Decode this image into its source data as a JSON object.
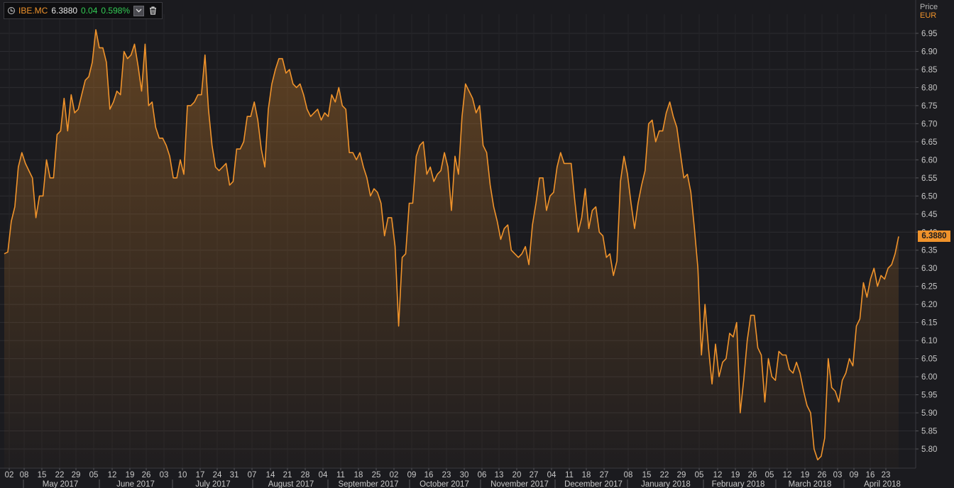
{
  "toolbar": {
    "ticker": "IBE.MC",
    "last_price": "6.3880",
    "change": "0.04",
    "change_pct": "0.598%",
    "dropdown_icon": "chevron-down-icon",
    "delete_icon": "trash-icon"
  },
  "axis_header": {
    "label": "Price",
    "currency": "EUR"
  },
  "last_value_badge": "6.3880",
  "colors": {
    "line": "#f0932b",
    "background": "#1b1b1f",
    "grid": "#2c2c31",
    "change_positive": "#33cc55"
  },
  "chart_data": {
    "type": "area",
    "ylim": [
      5.75,
      6.99
    ],
    "y_ticks": [
      "5.80",
      "5.85",
      "5.90",
      "5.95",
      "6.00",
      "6.05",
      "6.10",
      "6.15",
      "6.20",
      "6.25",
      "6.30",
      "6.35",
      "6.40",
      "6.45",
      "6.50",
      "6.55",
      "6.60",
      "6.65",
      "6.70",
      "6.75",
      "6.80",
      "6.85",
      "6.90",
      "6.95"
    ],
    "x_tick_labels": [
      "02",
      "08",
      "15",
      "22",
      "29",
      "05",
      "12",
      "19",
      "26",
      "03",
      "10",
      "17",
      "24",
      "31",
      "07",
      "14",
      "21",
      "28",
      "04",
      "11",
      "18",
      "25",
      "02",
      "09",
      "16",
      "23",
      "30",
      "06",
      "13",
      "20",
      "27",
      "04",
      "11",
      "18",
      "27",
      "08",
      "15",
      "22",
      "29",
      "05",
      "12",
      "19",
      "26",
      "05",
      "12",
      "19",
      "26",
      "03",
      "09",
      "16",
      "23"
    ],
    "month_labels": [
      "May 2017",
      "June 2017",
      "July 2017",
      "August 2017",
      "September 2017",
      "October 2017",
      "November 2017",
      "December 2017",
      "January 2018",
      "February 2018",
      "March 2018",
      "April 2018"
    ],
    "grid": true,
    "series": [
      {
        "values": [
          6.34,
          6.345,
          6.43,
          6.47,
          6.58,
          6.62,
          6.59,
          6.57,
          6.55,
          6.44,
          6.5,
          6.5,
          6.6,
          6.55,
          6.55,
          6.67,
          6.68,
          6.77,
          6.68,
          6.78,
          6.73,
          6.74,
          6.78,
          6.82,
          6.83,
          6.87,
          6.96,
          6.91,
          6.91,
          6.87,
          6.74,
          6.76,
          6.79,
          6.78,
          6.9,
          6.88,
          6.89,
          6.92,
          6.86,
          6.79,
          6.92,
          6.75,
          6.76,
          6.69,
          6.66,
          6.66,
          6.64,
          6.61,
          6.55,
          6.55,
          6.6,
          6.56,
          6.75,
          6.75,
          6.76,
          6.78,
          6.78,
          6.89,
          6.74,
          6.64,
          6.58,
          6.57,
          6.58,
          6.59,
          6.53,
          6.54,
          6.63,
          6.63,
          6.65,
          6.72,
          6.72,
          6.76,
          6.71,
          6.63,
          6.58,
          6.74,
          6.81,
          6.85,
          6.88,
          6.88,
          6.84,
          6.85,
          6.81,
          6.8,
          6.81,
          6.78,
          6.74,
          6.72,
          6.73,
          6.74,
          6.71,
          6.73,
          6.72,
          6.78,
          6.76,
          6.8,
          6.75,
          6.74,
          6.62,
          6.62,
          6.6,
          6.62,
          6.58,
          6.55,
          6.5,
          6.52,
          6.51,
          6.48,
          6.39,
          6.44,
          6.44,
          6.36,
          6.14,
          6.33,
          6.34,
          6.48,
          6.48,
          6.61,
          6.64,
          6.65,
          6.56,
          6.58,
          6.54,
          6.56,
          6.57,
          6.62,
          6.58,
          6.46,
          6.61,
          6.56,
          6.72,
          6.81,
          6.79,
          6.77,
          6.73,
          6.75,
          6.64,
          6.62,
          6.53,
          6.47,
          6.43,
          6.38,
          6.41,
          6.42,
          6.35,
          6.34,
          6.33,
          6.34,
          6.36,
          6.31,
          6.42,
          6.48,
          6.55,
          6.55,
          6.46,
          6.5,
          6.51,
          6.58,
          6.62,
          6.59,
          6.59,
          6.59,
          6.49,
          6.4,
          6.44,
          6.52,
          6.41,
          6.46,
          6.47,
          6.4,
          6.39,
          6.33,
          6.34,
          6.28,
          6.32,
          6.54,
          6.61,
          6.56,
          6.48,
          6.41,
          6.48,
          6.53,
          6.57,
          6.7,
          6.71,
          6.65,
          6.68,
          6.68,
          6.73,
          6.76,
          6.72,
          6.69,
          6.62,
          6.55,
          6.56,
          6.51,
          6.41,
          6.3,
          6.06,
          6.2,
          6.08,
          5.98,
          6.09,
          6.0,
          6.04,
          6.05,
          6.12,
          6.11,
          6.15,
          5.9,
          5.99,
          6.1,
          6.17,
          6.17,
          6.08,
          6.06,
          5.93,
          6.05,
          6.0,
          5.99,
          6.07,
          6.06,
          6.06,
          6.02,
          6.01,
          6.04,
          6.01,
          5.96,
          5.92,
          5.9,
          5.8,
          5.77,
          5.78,
          5.83,
          6.05,
          5.97,
          5.96,
          5.93,
          5.99,
          6.01,
          6.05,
          6.03,
          6.14,
          6.16,
          6.26,
          6.22,
          6.27,
          6.3,
          6.25,
          6.28,
          6.27,
          6.3,
          6.31,
          6.34,
          6.388
        ]
      }
    ]
  }
}
